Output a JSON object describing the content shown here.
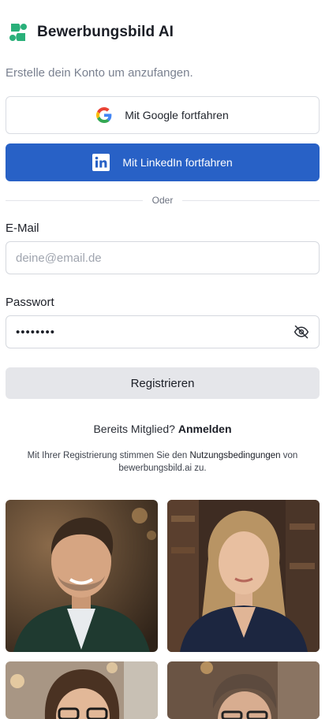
{
  "app": {
    "title": "Bewerbungsbild AI",
    "brand_color": "#2ab07a"
  },
  "intro": {
    "subtitle": "Erstelle dein Konto um anzufangen."
  },
  "auth": {
    "google_label": "Mit Google fortfahren",
    "linkedin_label": "Mit LinkedIn fortfahren",
    "linkedin_color": "#2861c6",
    "divider": "Oder"
  },
  "form": {
    "email_label": "E-Mail",
    "email_placeholder": "deine@email.de",
    "email_value": "",
    "password_label": "Passwort",
    "password_value": "••••••••",
    "register_label": "Registrieren"
  },
  "footer": {
    "member_text": "Bereits Mitglied?",
    "signin_link": "Anmelden",
    "terms_prefix": "Mit Ihrer Registrierung stimmen Sie den",
    "terms_link": "Nutzungsbedingungen",
    "terms_suffix": "von bewerbungsbild.ai zu."
  },
  "gallery": {
    "photos": [
      {
        "subject": "smiling-man-green-suit"
      },
      {
        "subject": "blonde-woman-navy-blazer"
      },
      {
        "subject": "woman-with-glasses"
      },
      {
        "subject": "man-with-glasses"
      }
    ]
  }
}
